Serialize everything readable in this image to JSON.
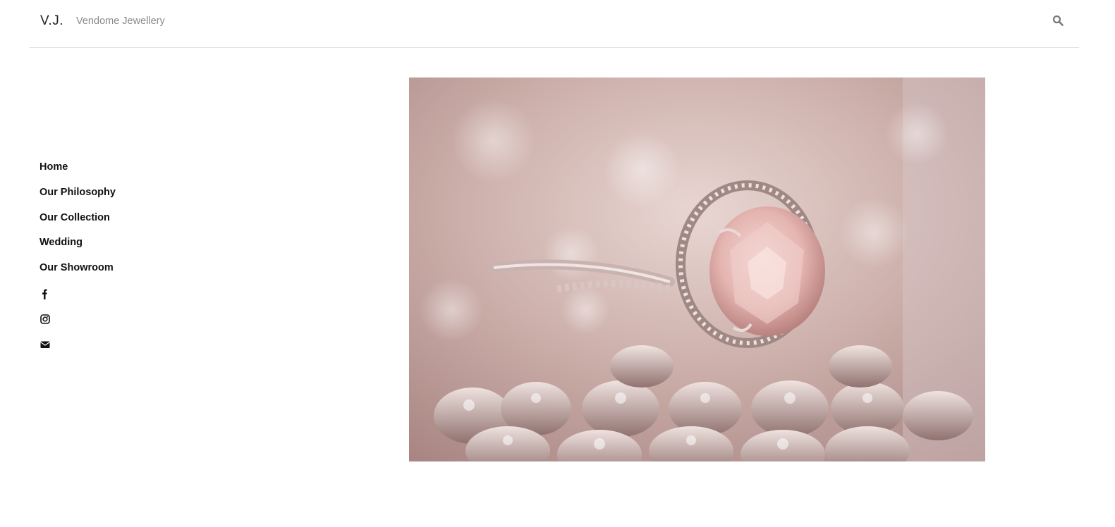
{
  "header": {
    "logo": "V.J.",
    "tagline": "Vendome Jewellery",
    "search_icon": "search-icon"
  },
  "nav": {
    "items": [
      {
        "label": "Home"
      },
      {
        "label": "Our Philosophy"
      },
      {
        "label": "Our Collection"
      },
      {
        "label": "Wedding"
      },
      {
        "label": "Our Showroom"
      }
    ],
    "social": [
      {
        "icon": "facebook-icon"
      },
      {
        "icon": "instagram-icon"
      },
      {
        "icon": "envelope-icon"
      }
    ]
  },
  "hero": {
    "image": "photo of a pink gemstone ring resting on sparkling crystals"
  }
}
